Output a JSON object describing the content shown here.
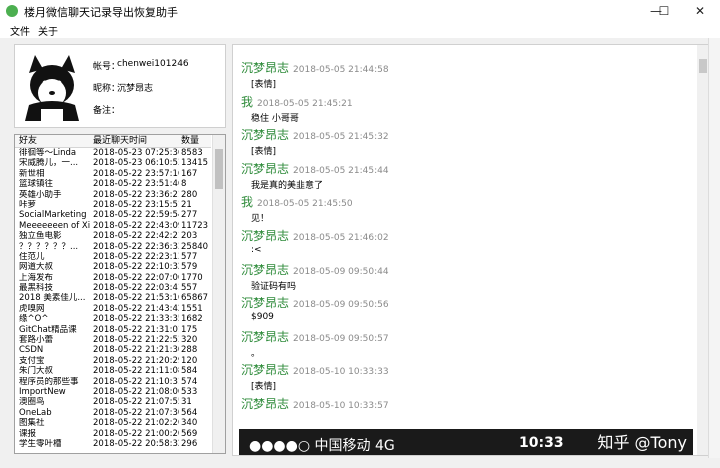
{
  "window": {
    "title": "楼月微信聊天记录导出恢复助手",
    "controls": {
      "minimize": "—",
      "maximize": "☐",
      "close": "✕"
    }
  },
  "menu": {
    "file": "文件",
    "about": "关于"
  },
  "profile": {
    "account_label": "帐号：",
    "account_value": "chenwei101246",
    "nickname_label": "昵称：",
    "nickname_value": "沉梦昂志",
    "remark_label": "备注："
  },
  "contacts": {
    "headers": {
      "name": "好友",
      "time": "最近聊天时间",
      "count": "数量"
    },
    "rows": [
      {
        "name": "徘徊等～Linda",
        "time": "2018-05-23 07:25:36",
        "count": "8583"
      },
      {
        "name": "宋威腾儿，一...",
        "time": "2018-05-23 06:10:53",
        "count": "13415"
      },
      {
        "name": "新世相",
        "time": "2018-05-22 23:57:16",
        "count": "167"
      },
      {
        "name": "篮球镇往",
        "time": "2018-05-22 23:51:46",
        "count": "8"
      },
      {
        "name": "英雄小助手",
        "time": "2018-05-22 23:36:21",
        "count": "280"
      },
      {
        "name": "咔萝",
        "time": "2018-05-22 23:15:51",
        "count": "21"
      },
      {
        "name": "SocialMarketing",
        "time": "2018-05-22 22:59:54",
        "count": "277"
      },
      {
        "name": "Meeeeeeen of Xi...",
        "time": "2018-05-22 22:43:09",
        "count": "11723"
      },
      {
        "name": "独立鱼电影",
        "time": "2018-05-22 22:42:21",
        "count": "203"
      },
      {
        "name": "？？？？？？...",
        "time": "2018-05-22 22:36:33",
        "count": "25840"
      },
      {
        "name": "住范儿",
        "time": "2018-05-22 22:23:13",
        "count": "577"
      },
      {
        "name": "网道大叔",
        "time": "2018-05-22 22:10:32",
        "count": "579"
      },
      {
        "name": "上海发布",
        "time": "2018-05-22 22:07:06",
        "count": "1770"
      },
      {
        "name": "最黑科技",
        "time": "2018-05-22 22:03:41",
        "count": "557"
      },
      {
        "name": "2018 美素佳儿...",
        "time": "2018-05-22 21:53:16",
        "count": "65867"
      },
      {
        "name": "虎嗅网",
        "time": "2018-05-22 21:43:42",
        "count": "1551"
      },
      {
        "name": "缘^O^",
        "time": "2018-05-22 21:33:35",
        "count": "1682"
      },
      {
        "name": "GitChat精品课",
        "time": "2018-05-22 21:31:01",
        "count": "175"
      },
      {
        "name": "套路小蕾",
        "time": "2018-05-22 21:22:53",
        "count": "320"
      },
      {
        "name": "CSDN",
        "time": "2018-05-22 21:21:30",
        "count": "288"
      },
      {
        "name": "支付宝",
        "time": "2018-05-22 21:20:29",
        "count": "120"
      },
      {
        "name": "朱门大叔",
        "time": "2018-05-22 21:11:08",
        "count": "584"
      },
      {
        "name": "程序员的那些事",
        "time": "2018-05-22 21:10:31",
        "count": "574"
      },
      {
        "name": "ImportNew",
        "time": "2018-05-22 21:08:06",
        "count": "533"
      },
      {
        "name": "澳圈鸟",
        "time": "2018-05-22 21:07:55",
        "count": "31"
      },
      {
        "name": "OneLab",
        "time": "2018-05-22 21:07:30",
        "count": "564"
      },
      {
        "name": "图集社",
        "time": "2018-05-22 21:02:26",
        "count": "340"
      },
      {
        "name": "课报",
        "time": "2018-05-22 21:00:20",
        "count": "569"
      },
      {
        "name": "学生零叶槽",
        "time": "2018-05-22 20:58:32",
        "count": "296"
      }
    ]
  },
  "messages": [
    {
      "sender": "沉梦昂志",
      "time": "2018-05-05 21:44:58",
      "text": "[表情]"
    },
    {
      "sender": "我",
      "time": "2018-05-05 21:45:21",
      "text": "稳住 小哥哥"
    },
    {
      "sender": "沉梦昂志",
      "time": "2018-05-05 21:45:32",
      "text": "[表情]"
    },
    {
      "sender": "沉梦昂志",
      "time": "2018-05-05 21:45:44",
      "text": "我是真的美韭意了"
    },
    {
      "sender": "我",
      "time": "2018-05-05 21:45:50",
      "text": "见！"
    },
    {
      "sender": "沉梦昂志",
      "time": "2018-05-05 21:46:02",
      "text": ":<"
    },
    {
      "sender": "沉梦昂志",
      "time": "2018-05-09 09:50:44",
      "text": "验证码有吗"
    },
    {
      "sender": "沉梦昂志",
      "time": "2018-05-09 09:50:56",
      "text": "$909"
    },
    {
      "sender": "沉梦昂志",
      "time": "2018-05-09 09:50:57",
      "text": "。"
    },
    {
      "sender": "沉梦昂志",
      "time": "2018-05-10 10:33:33",
      "text": "[表情]"
    },
    {
      "sender": "沉梦昂志",
      "time": "2018-05-10 10:33:57",
      "text": ""
    }
  ],
  "phone_status": {
    "carrier": "●●●●○ 中国移动  4G",
    "clock": "10:33"
  },
  "watermark": "知乎 @Tony"
}
